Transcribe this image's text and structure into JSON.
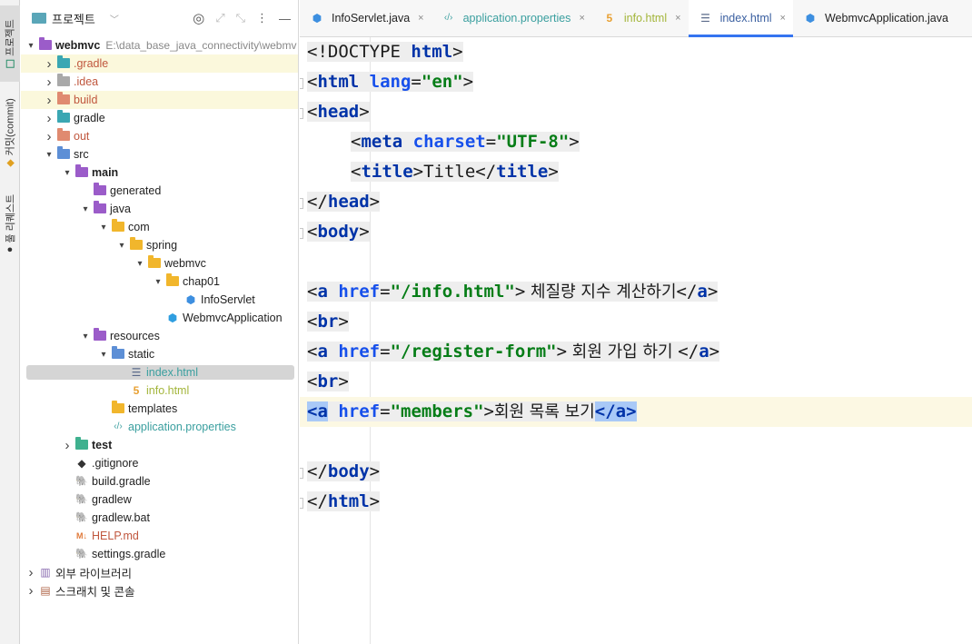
{
  "tool_strip": {
    "project_label": "프로젝트",
    "commit_label": "커밋(commit)",
    "pr_label": "풀 리퀘스트"
  },
  "project_panel": {
    "title": "프로젝트",
    "root": {
      "name": "webmvc",
      "path": "E:\\data_base_java_connectivity\\webmv"
    },
    "tree": [
      {
        "depth": 1,
        "arrow": "right",
        "icon": "folder-teal",
        "label": ".gradle",
        "color": "orange",
        "highlight": true
      },
      {
        "depth": 1,
        "arrow": "right",
        "icon": "folder-gray",
        "label": ".idea",
        "color": "orange",
        "highlight": false
      },
      {
        "depth": 1,
        "arrow": "right",
        "icon": "folder-orange",
        "label": "build",
        "color": "orange",
        "highlight": true
      },
      {
        "depth": 1,
        "arrow": "right",
        "icon": "folder-teal",
        "label": "gradle",
        "color": "normal",
        "highlight": false
      },
      {
        "depth": 1,
        "arrow": "right",
        "icon": "folder-orange",
        "label": "out",
        "color": "orange",
        "highlight": false
      },
      {
        "depth": 1,
        "arrow": "down",
        "icon": "folder-blue",
        "label": "src",
        "color": "normal",
        "highlight": false
      },
      {
        "depth": 2,
        "arrow": "down",
        "icon": "folder-purple",
        "label": "main",
        "color": "bold",
        "highlight": false
      },
      {
        "depth": 3,
        "arrow": "none",
        "icon": "folder-purple",
        "label": "generated",
        "color": "normal",
        "highlight": false
      },
      {
        "depth": 3,
        "arrow": "down",
        "icon": "folder-purple",
        "label": "java",
        "color": "normal",
        "highlight": false
      },
      {
        "depth": 4,
        "arrow": "down",
        "icon": "folder-yellow",
        "label": "com",
        "color": "normal",
        "highlight": false
      },
      {
        "depth": 5,
        "arrow": "down",
        "icon": "folder-yellow",
        "label": "spring",
        "color": "normal",
        "highlight": false
      },
      {
        "depth": 6,
        "arrow": "down",
        "icon": "folder-yellow",
        "label": "webmvc",
        "color": "normal",
        "highlight": false
      },
      {
        "depth": 7,
        "arrow": "down",
        "icon": "folder-yellow",
        "label": "chap01",
        "color": "normal",
        "highlight": false
      },
      {
        "depth": 8,
        "arrow": "none",
        "icon": "java-class",
        "label": "InfoServlet",
        "color": "normal",
        "highlight": false
      },
      {
        "depth": 7,
        "arrow": "none",
        "icon": "spring-class",
        "label": "WebmvcApplication",
        "color": "normal",
        "highlight": false
      },
      {
        "depth": 3,
        "arrow": "down",
        "icon": "folder-purple",
        "label": "resources",
        "color": "normal",
        "highlight": false
      },
      {
        "depth": 4,
        "arrow": "down",
        "icon": "folder-blue",
        "label": "static",
        "color": "normal",
        "highlight": false
      },
      {
        "depth": 5,
        "arrow": "none",
        "icon": "html-file",
        "label": "index.html",
        "color": "teal",
        "highlight": false,
        "selected": true
      },
      {
        "depth": 5,
        "arrow": "none",
        "icon": "html5-file",
        "label": "info.html",
        "color": "ygreen",
        "highlight": false
      },
      {
        "depth": 4,
        "arrow": "none",
        "icon": "folder-yellow",
        "label": "templates",
        "color": "normal",
        "highlight": false
      },
      {
        "depth": 4,
        "arrow": "none",
        "icon": "properties-file",
        "label": "application.properties",
        "color": "teal",
        "highlight": false
      },
      {
        "depth": 2,
        "arrow": "right",
        "icon": "folder-green",
        "label": "test",
        "color": "bold",
        "highlight": false
      },
      {
        "depth": 2,
        "arrow": "none",
        "icon": "git-file",
        "label": ".gitignore",
        "color": "normal",
        "highlight": false
      },
      {
        "depth": 2,
        "arrow": "none",
        "icon": "gradle-file",
        "label": "build.gradle",
        "color": "normal",
        "highlight": false
      },
      {
        "depth": 2,
        "arrow": "none",
        "icon": "gradle-file",
        "label": "gradlew",
        "color": "normal",
        "highlight": false
      },
      {
        "depth": 2,
        "arrow": "none",
        "icon": "gradle-file",
        "label": "gradlew.bat",
        "color": "normal",
        "highlight": false
      },
      {
        "depth": 2,
        "arrow": "none",
        "icon": "markdown-file",
        "label": "HELP.md",
        "color": "orange",
        "highlight": false
      },
      {
        "depth": 2,
        "arrow": "none",
        "icon": "gradle-file",
        "label": "settings.gradle",
        "color": "normal",
        "highlight": false
      },
      {
        "depth": 0,
        "arrow": "right",
        "icon": "library",
        "label": "외부 라이브러리",
        "color": "normal",
        "highlight": false
      },
      {
        "depth": 0,
        "arrow": "right",
        "icon": "scratch",
        "label": "스크래치 및 콘솔",
        "color": "normal",
        "highlight": false
      }
    ]
  },
  "editor": {
    "tabs": [
      {
        "label": "InfoServlet.java",
        "icon": "java-class",
        "style": "normal",
        "active": false
      },
      {
        "label": "application.properties",
        "icon": "properties-file",
        "style": "teal",
        "active": false
      },
      {
        "label": "info.html",
        "icon": "html5-file",
        "style": "ygreen",
        "active": false
      },
      {
        "label": "index.html",
        "icon": "html-file",
        "style": "normal",
        "active": true
      },
      {
        "label": "WebmvcApplication.java",
        "icon": "java-class",
        "style": "normal",
        "active": false
      }
    ],
    "current_line": 13,
    "lines": [
      {
        "n": "1",
        "fold": false,
        "mark": "",
        "tokens": [
          [
            "t",
            "<!DOCTYPE "
          ],
          [
            "tag",
            "html"
          ],
          [
            "t",
            ">"
          ]
        ]
      },
      {
        "n": "2",
        "fold": true,
        "mark": "",
        "tokens": [
          [
            "t",
            "<"
          ],
          [
            "tag",
            "html "
          ],
          [
            "attr",
            "lang"
          ],
          [
            "t",
            "="
          ],
          [
            "val",
            "\"en\""
          ],
          [
            "t",
            ">"
          ]
        ]
      },
      {
        "n": "3",
        "fold": true,
        "mark": "",
        "tokens": [
          [
            "t",
            "<"
          ],
          [
            "tag",
            "head"
          ],
          [
            "t",
            ">"
          ]
        ]
      },
      {
        "n": "4",
        "fold": false,
        "mark": "",
        "indent": "    ",
        "tokens": [
          [
            "t",
            "<"
          ],
          [
            "tag",
            "meta "
          ],
          [
            "attr",
            "charset"
          ],
          [
            "t",
            "="
          ],
          [
            "val",
            "\"UTF-8\""
          ],
          [
            "t",
            ">"
          ]
        ]
      },
      {
        "n": "5",
        "fold": false,
        "mark": "",
        "indent": "    ",
        "tokens": [
          [
            "t",
            "<"
          ],
          [
            "tag",
            "title"
          ],
          [
            "t",
            ">Title</"
          ],
          [
            "tag",
            "title"
          ],
          [
            "t",
            ">"
          ]
        ]
      },
      {
        "n": "6",
        "fold": true,
        "mark": "",
        "tokens": [
          [
            "t",
            "</"
          ],
          [
            "tag",
            "head"
          ],
          [
            "t",
            ">"
          ]
        ]
      },
      {
        "n": "7",
        "fold": true,
        "mark": "",
        "tokens": [
          [
            "t",
            "<"
          ],
          [
            "tag",
            "body"
          ],
          [
            "t",
            ">"
          ]
        ]
      },
      {
        "n": "8",
        "fold": false,
        "mark": "",
        "tokens": []
      },
      {
        "n": "9",
        "fold": false,
        "mark": "blue",
        "tokens": [
          [
            "t",
            "<"
          ],
          [
            "tag",
            "a "
          ],
          [
            "attr",
            "href"
          ],
          [
            "t",
            "="
          ],
          [
            "val",
            "\"/info.html\""
          ],
          [
            "t",
            ">"
          ],
          [
            "kr",
            " 체질량 지수 계산하기"
          ],
          [
            "t",
            "</"
          ],
          [
            "tag",
            "a"
          ],
          [
            "t",
            ">"
          ]
        ]
      },
      {
        "n": "10",
        "fold": false,
        "mark": "tan",
        "tokens": [
          [
            "t",
            "<"
          ],
          [
            "tag",
            "br"
          ],
          [
            "t",
            ">"
          ]
        ]
      },
      {
        "n": "11",
        "fold": false,
        "mark": "blue",
        "tokens": [
          [
            "t",
            "<"
          ],
          [
            "tag",
            "a "
          ],
          [
            "attr",
            "href"
          ],
          [
            "t",
            "="
          ],
          [
            "val",
            "\"/register-form\""
          ],
          [
            "t",
            ">"
          ],
          [
            "kr",
            " 회원 가입 하기 "
          ],
          [
            "t",
            "</"
          ],
          [
            "tag",
            "a"
          ],
          [
            "t",
            ">"
          ]
        ]
      },
      {
        "n": "12",
        "fold": false,
        "mark": "tan",
        "tokens": [
          [
            "t",
            "<"
          ],
          [
            "tag",
            "br"
          ],
          [
            "t",
            ">"
          ]
        ]
      },
      {
        "n": "13",
        "fold": false,
        "mark": "blue",
        "tokens": [
          [
            "hl",
            "<a"
          ],
          [
            "t",
            " "
          ],
          [
            "attr",
            "href"
          ],
          [
            "t",
            "="
          ],
          [
            "val",
            "\"members\""
          ],
          [
            "t",
            ">"
          ],
          [
            "kr",
            "회원 목록 보기"
          ],
          [
            "hl",
            "</a>"
          ]
        ]
      },
      {
        "n": "14",
        "fold": false,
        "mark": "",
        "tokens": []
      },
      {
        "n": "15",
        "fold": true,
        "mark": "",
        "tokens": [
          [
            "t",
            "</"
          ],
          [
            "tag",
            "body"
          ],
          [
            "t",
            ">"
          ]
        ]
      },
      {
        "n": "16",
        "fold": true,
        "mark": "",
        "tokens": [
          [
            "t",
            "</"
          ],
          [
            "tag",
            "html"
          ],
          [
            "t",
            ">"
          ]
        ]
      }
    ]
  },
  "colors": {
    "tag": "#0033a8",
    "attribute": "#1750eb",
    "value": "#067d17",
    "active_tab_underline": "#3574f0",
    "current_line_bg": "#fcf8e3"
  }
}
